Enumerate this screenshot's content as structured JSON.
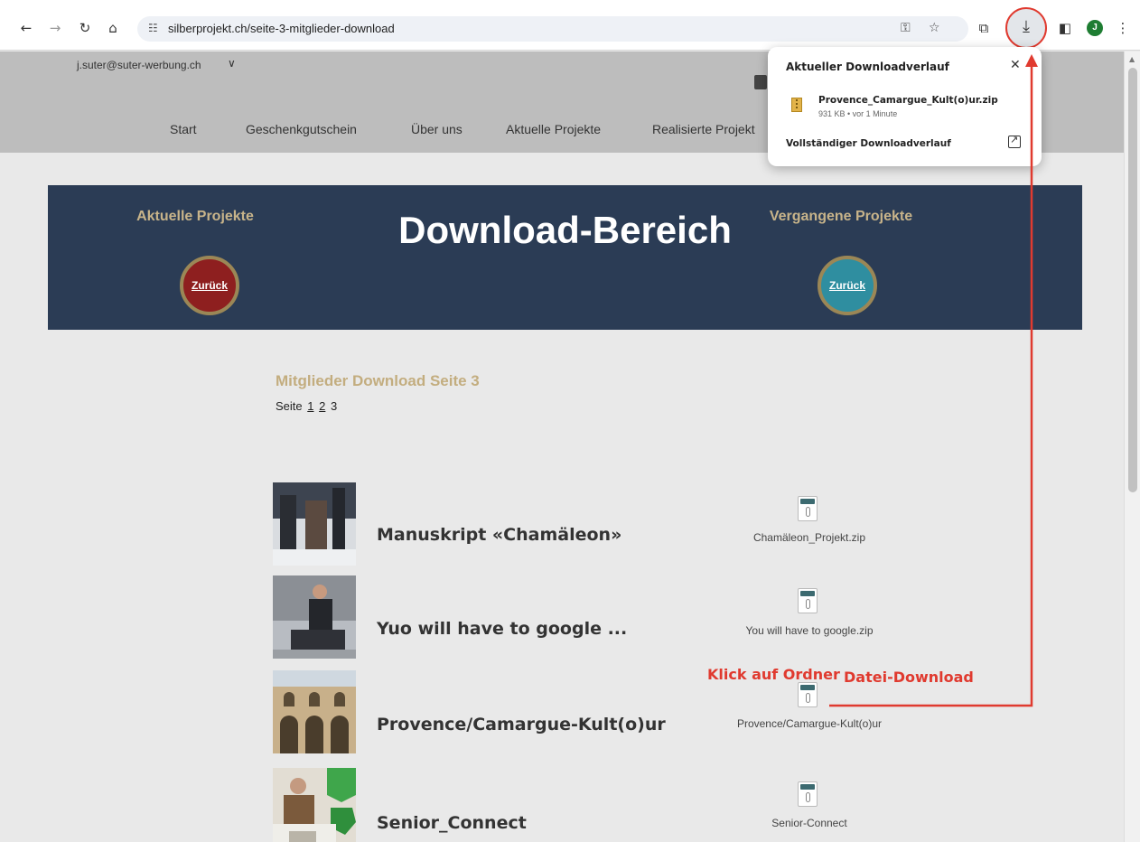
{
  "browser": {
    "url": "silberprojekt.ch/seite-3-mitglieder-download",
    "avatar_letter": "J"
  },
  "site": {
    "user_email": "j.suter@suter-werbung.ch",
    "nav": [
      "Start",
      "Geschenkgutschein",
      "Über uns",
      "Aktuelle Projekte",
      "Realisierte Projekt"
    ]
  },
  "banner": {
    "title": "Download-Bereich",
    "left_label": "Aktuelle Projekte",
    "right_label": "Vergangene Projekte",
    "back_label": "Zurück",
    "colors": {
      "background": "#2b3c55",
      "left_button": "#8e1f1f",
      "right_button": "#2f8ea0",
      "label": "#c8b48a"
    }
  },
  "content": {
    "heading": "Mitglieder Download Seite 3",
    "pager_prefix": "Seite",
    "pages": [
      "1",
      "2",
      "3"
    ],
    "current_page": "3",
    "items": [
      {
        "title": "Manuskript «Chamäleon»",
        "file": "Chamäleon_Projekt.zip"
      },
      {
        "title": "Yuo will have to google ...",
        "file": "You will have to google.zip"
      },
      {
        "title": "Provence/Camargue-Kult(o)ur",
        "file": "Provence/Camargue-Kult(o)ur"
      },
      {
        "title": "Senior_Connect",
        "file": "Senior-Connect"
      }
    ],
    "file_tag": "ATT"
  },
  "annotations": {
    "click_folder": "Klick auf Ordner",
    "file_download": "Datei-Download",
    "color": "#e03a2f"
  },
  "download_popup": {
    "title": "Aktueller Downloadverlauf",
    "file_name": "Provence_Camargue_Kult(o)ur.zip",
    "file_meta": "931 KB • vor 1 Minute",
    "full_history": "Vollständiger Downloadverlauf"
  }
}
